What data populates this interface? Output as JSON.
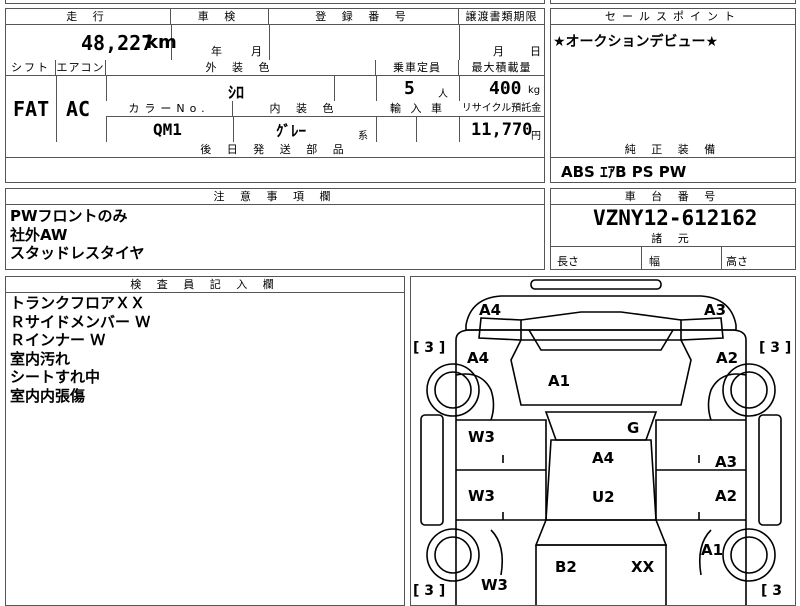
{
  "headers": {
    "mileage": "走 行",
    "inspection": "車 検",
    "registration_no": "登 録 番 号",
    "transfer_deadline": "譲渡書類期限",
    "sales_point": "セールスポイント",
    "shift": "シフト",
    "aircon": "エアコン",
    "exterior_color": "外 装 色",
    "capacity": "乗車定員",
    "max_load": "最大積載量",
    "color_no": "カラーNo.",
    "interior_color": "内 装 色",
    "import": "輸 入 車",
    "recycle": "リサイクル預託金",
    "later_parts": "後 日 発 送 部 品",
    "standard_equipment": "純 正 装 備",
    "notes": "注 意 事 項 欄",
    "chassis_no": "車 台 番 号",
    "dimensions": "諸 元",
    "inspector": "検 査 員 記 入 欄"
  },
  "vehicle": {
    "mileage": "48,227",
    "mileage_unit": "km",
    "year_label": "年",
    "month_label": "月",
    "day_label": "日",
    "shift": "FAT",
    "aircon": "AC",
    "exterior_color": "ｼﾛ",
    "capacity": "5",
    "capacity_unit": "人",
    "max_load": "400",
    "max_load_unit": "kg",
    "color_no": "QM1",
    "interior_color": "ｸﾞﾚｰ",
    "interior_suffix": "系",
    "recycle_fee": "11,770",
    "recycle_unit": "円",
    "sales_point": "★オークションデビュー★",
    "equipment": "ABS ｴｱB PS PW",
    "chassis_no": "VZNY12-612162",
    "length_label": "長さ",
    "width_label": "幅",
    "height_label": "高さ"
  },
  "notes": [
    "PWフロントのみ",
    "社外AW",
    "スタッドレスタイヤ"
  ],
  "inspector_notes": [
    "トランクフロアＸＸ",
    "Ｒサイドメンバー Ｗ",
    "Ｒインナー Ｗ",
    "室内汚れ",
    "シートすれ中",
    "室内内張傷"
  ],
  "diagram": {
    "tread_left_top": "[ 3 ]",
    "tread_right_top": "[ 3 ]",
    "tread_left_bottom": "[ 3 ]",
    "tread_right_bottom": "[ 3",
    "labels": {
      "front_bumper_left": "A4",
      "front_bumper_right": "A3",
      "fender_left": "A4",
      "fender_right": "A2",
      "bonnet": "A1",
      "glass": "G",
      "front_door_left": "W3",
      "front_door_right": "A3",
      "roof": "A4",
      "rear_door_left": "W3",
      "rear_door_right": "A2",
      "roof_rear": "U2",
      "quarter_right": "A1",
      "rear_left": "W3",
      "trunk_left": "B2",
      "trunk_right": "XX"
    }
  }
}
